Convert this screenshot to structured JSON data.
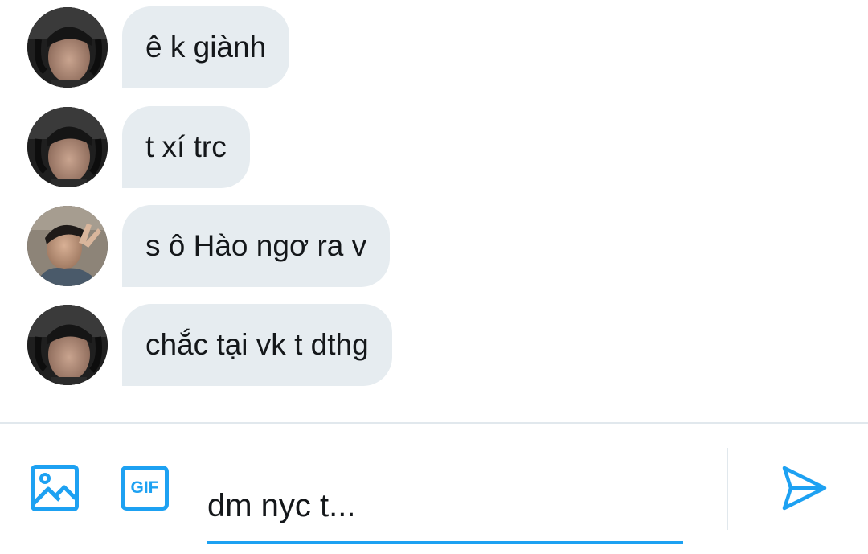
{
  "colors": {
    "accent": "#1da1f2",
    "bubble_bg": "#e6ecf0",
    "text": "#14171a",
    "divider": "#e1e8ed"
  },
  "messages": [
    {
      "sender": "user-a",
      "text": "ê k giành"
    },
    {
      "sender": "user-a",
      "text": "t xí trc"
    },
    {
      "sender": "user-b",
      "text": "s ô Hào ngơ ra v"
    },
    {
      "sender": "user-a",
      "text": "chắc tại vk t dthg"
    }
  ],
  "composer": {
    "image_icon": "image-icon",
    "gif_label": "GIF",
    "input_value": "dm nyc t...",
    "send_icon": "send-icon"
  }
}
